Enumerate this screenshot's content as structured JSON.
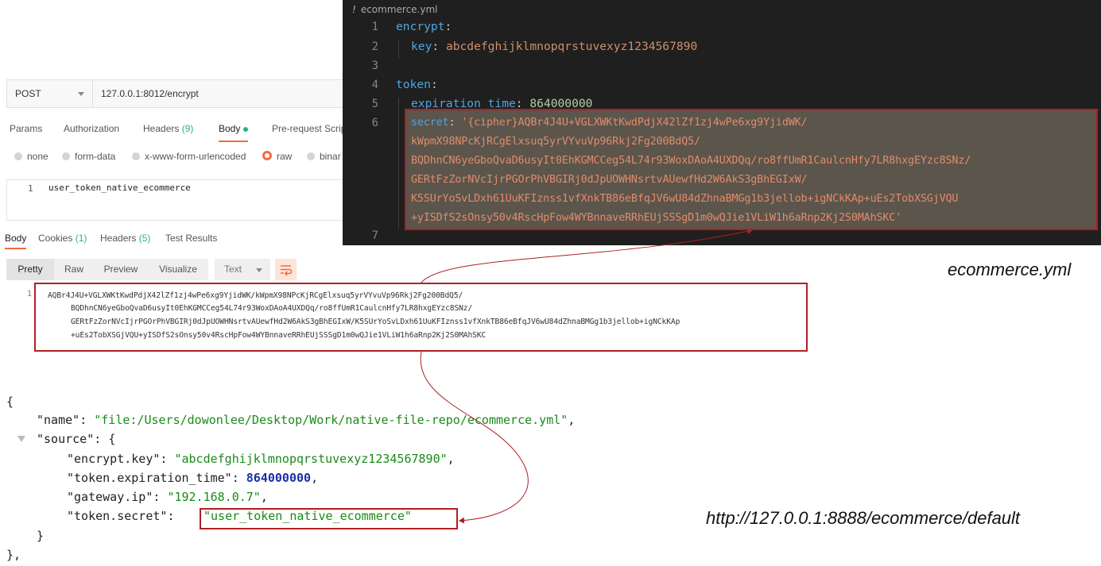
{
  "postman": {
    "method": "POST",
    "url": "127.0.0.1:8012/encrypt",
    "request_tabs": [
      {
        "label": "Params",
        "badge": ""
      },
      {
        "label": "Authorization",
        "badge": ""
      },
      {
        "label": "Headers",
        "badge": "(9)"
      },
      {
        "label": "Body",
        "badge": ""
      },
      {
        "label": "Pre-request Scrip",
        "badge": ""
      }
    ],
    "body_modes": [
      "none",
      "form-data",
      "x-www-form-urlencoded",
      "raw",
      "binar"
    ],
    "body_editor": {
      "line": "1",
      "text": "user_token_native_ecommerce"
    },
    "response_tabs": [
      {
        "label": "Body",
        "badge": ""
      },
      {
        "label": "Cookies",
        "badge": "(1)"
      },
      {
        "label": "Headers",
        "badge": "(5)"
      },
      {
        "label": "Test Results",
        "badge": ""
      }
    ],
    "view_modes": [
      "Pretty",
      "Raw",
      "Preview",
      "Visualize"
    ],
    "format": "Text",
    "response": {
      "line": "1",
      "lines": [
        "AQBr4J4U+VGLXWKtKwdPdjX42lZf1zj4wPe6xg9YjidWK/kWpmX98NPcKjRCgElxsuq5yrVYvuVp96Rkj2Fg200BdQ5/",
        "BQDhnCN6yeGboQvaD6usyIt0EhKGMCCeg54L74r93WoxDAoA4UXDQq/ro8ffUmR1CaulcnHfy7LR8hxgEYzc8SNz/",
        "GERtFzZorNVcIjrPGOrPhVBGIRj0dJpUOWHNsrtvAUewfHd2W6AkS3gBhEGIxW/K5SUrYoSvLDxh61UuKFIznss1vfXnkTB86eBfqJV6wU84dZhnaBMGg1b3jellob+igNCkKAp",
        "+uEs2TobXSGjVQU+yISDfS2sOnsy50v4RscHpFow4WYBnnaveRRhEUjSSSgD1m0wQJie1VLiW1h6aRnp2Kj2S0MAhSKC"
      ]
    }
  },
  "editor": {
    "tab_marker": "!",
    "filename": "ecommerce.yml",
    "line_numbers": [
      "1",
      "2",
      "3",
      "4",
      "5",
      "6",
      "7"
    ],
    "encrypt_key": "encrypt",
    "key_key": "key",
    "key_value": "abcdefghijklmnopqrstuvexyz1234567890",
    "token_key": "token",
    "expiration_key": "expiration_time",
    "expiration_value": "864000000",
    "secret_key": "secret",
    "secret_lines": [
      "'{cipher}AQBr4J4U+VGLXWKtKwdPdjX42lZf1zj4wPe6xg9YjidWK/",
      "kWpmX98NPcKjRCgElxsuq5yrVYvuVp96Rkj2Fg200BdQ5/",
      "BQDhnCN6yeGboQvaD6usyIt0EhKGMCCeg54L74r93WoxDAoA4UXDQq/ro8ffUmR1CaulcnHfy7LR8hxgEYzc8SNz/",
      "GERtFzZorNVcIjrPGOrPhVBGIRj0dJpUOWHNsrtvAUewfHd2W6AkS3gBhEGIxW/",
      "K5SUrYoSvLDxh61UuKFIznss1vfXnkTB86eBfqJV6wU84dZhnaBMGg1b3jellob+igNCkKAp+uEs2TobXSGjVQU",
      "+yISDfS2sOnsy50v4RscHpFow4WYBnnaveRRhEUjSSSgD1m0wQJie1VLiW1h6aRnp2Kj2S0MAhSKC'"
    ]
  },
  "captions": {
    "yml": "ecommerce.yml",
    "url": "http://127.0.0.1:8888/ecommerce/default"
  },
  "json": {
    "open_brace": "{",
    "name_key": "\"name\"",
    "name_value": "\"file:/Users/dowonlee/Desktop/Work/native-file-repo/ecommerce.yml\"",
    "source_key": "\"source\"",
    "source_open": "{",
    "encrypt_key_key": "\"encrypt.key\"",
    "encrypt_key_value": "\"abcdefghijklmnopqrstuvexyz1234567890\"",
    "expiration_key": "\"token.expiration_time\"",
    "expiration_value": "864000000",
    "gateway_key": "\"gateway.ip\"",
    "gateway_value": "\"192.168.0.7\"",
    "secret_key": "\"token.secret\"",
    "secret_value": "\"user_token_native_ecommerce\"",
    "source_close": "}",
    "close_brace": "},"
  },
  "colors": {
    "highlight_border": "#b11f24",
    "arrow": "#b11f24",
    "accent": "#f26b3a",
    "badge_green": "#26b47f"
  }
}
